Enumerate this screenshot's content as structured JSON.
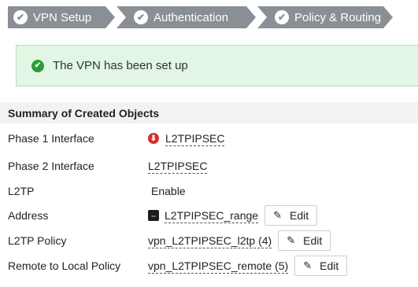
{
  "wizard": {
    "steps": [
      {
        "label": "VPN Setup",
        "icon": "check-circle-icon"
      },
      {
        "label": "Authentication",
        "icon": "check-circle-icon"
      },
      {
        "label": "Policy & Routing",
        "icon": "check-circle-icon"
      }
    ],
    "step_color": "#8a8e95"
  },
  "banner": {
    "icon": "check-circle-icon",
    "message": "The VPN has been set up",
    "bg_color": "#e3f5e4",
    "icon_color": "#2e9b3a"
  },
  "summary": {
    "title": "Summary of Created Objects",
    "rows": [
      {
        "label": "Phase 1 Interface",
        "value": "L2TPIPSEC",
        "icon": "interface-down-icon"
      },
      {
        "label": "Phase 2 Interface",
        "value": "L2TPIPSEC"
      },
      {
        "label": "L2TP",
        "value": "Enable"
      },
      {
        "label": "Address",
        "value": "L2TPIPSEC_range",
        "icon": "address-range-icon",
        "edit": "Edit"
      },
      {
        "label": "L2TP Policy",
        "value": "vpn_L2TPIPSEC_l2tp (4)",
        "edit": "Edit"
      },
      {
        "label": "Remote to Local Policy",
        "value": "vpn_L2TPIPSEC_remote (5)",
        "edit": "Edit"
      }
    ]
  }
}
